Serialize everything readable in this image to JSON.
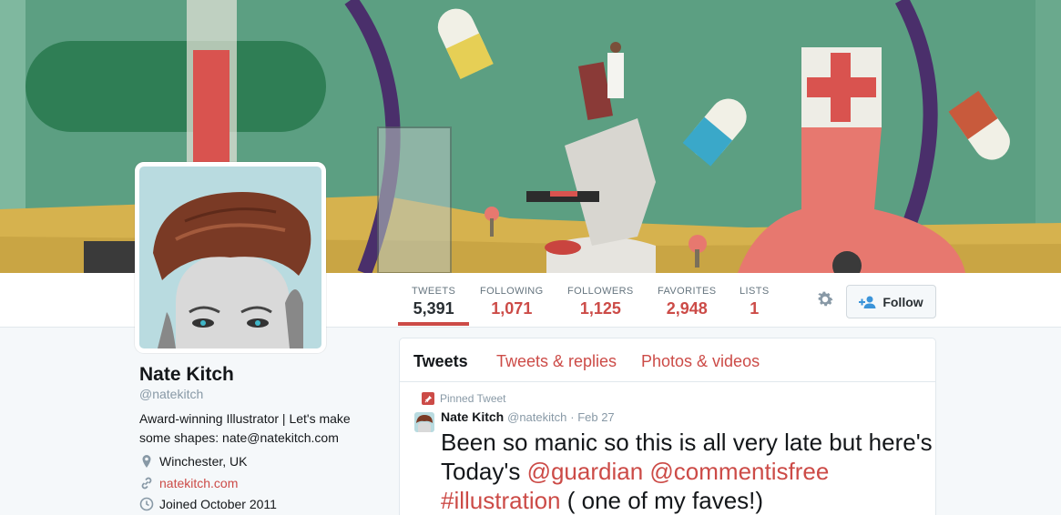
{
  "profile": {
    "name": "Nate Kitch",
    "handle": "@natekitch",
    "bio": "Award-winning Illustrator | Let's make some shapes: nate@natekitch.com",
    "location": "Winchester, UK",
    "website": "natekitch.com",
    "joined": "Joined October 2011"
  },
  "stats": [
    {
      "label": "TWEETS",
      "value": "5,391"
    },
    {
      "label": "FOLLOWING",
      "value": "1,071"
    },
    {
      "label": "FOLLOWERS",
      "value": "1,125"
    },
    {
      "label": "FAVORITES",
      "value": "2,948"
    },
    {
      "label": "LISTS",
      "value": "1"
    }
  ],
  "actions": {
    "follow_label": "Follow",
    "settings_icon": "gear-icon"
  },
  "tabs": [
    {
      "label": "Tweets"
    },
    {
      "label": "Tweets & replies"
    },
    {
      "label": "Photos & videos"
    }
  ],
  "tweet": {
    "pinned_label": "Pinned Tweet",
    "author": "Nate Kitch",
    "handle": "@natekitch",
    "date": "· Feb 27",
    "text_1": "Been so manic so this is all very late but here's Today's ",
    "mention_1": "@guardian",
    "mention_2": "@commentisfree",
    "hashtag": "#illustration",
    "text_2": " ( one of my faves!)"
  },
  "colors": {
    "accent": "#cc4b47",
    "banner_green": "#5a9e80"
  }
}
